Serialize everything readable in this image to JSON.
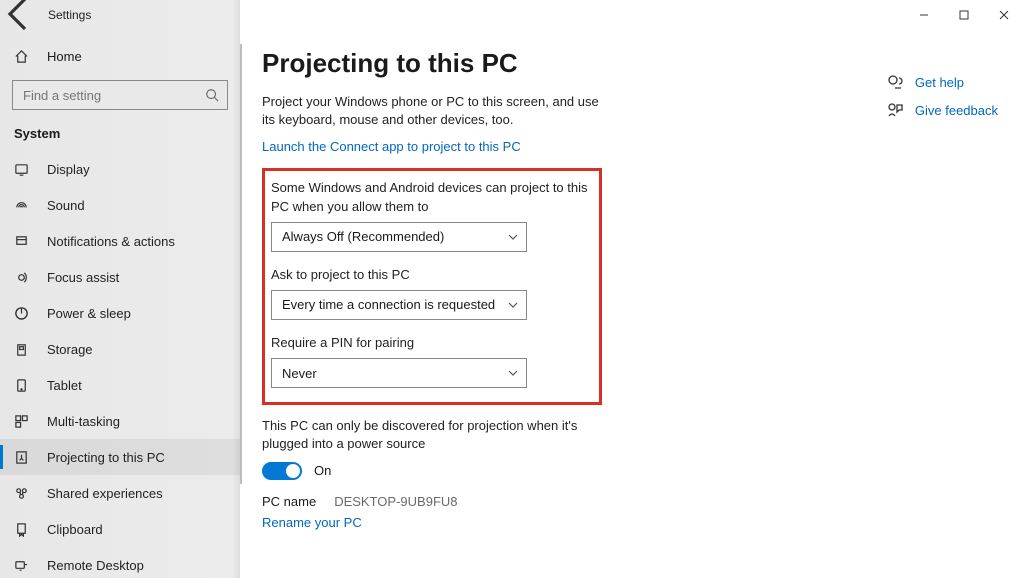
{
  "window": {
    "title": "Settings"
  },
  "sidebar": {
    "home": "Home",
    "search_placeholder": "Find a setting",
    "section": "System",
    "items": [
      {
        "label": "Display"
      },
      {
        "label": "Sound"
      },
      {
        "label": "Notifications & actions"
      },
      {
        "label": "Focus assist"
      },
      {
        "label": "Power & sleep"
      },
      {
        "label": "Storage"
      },
      {
        "label": "Tablet"
      },
      {
        "label": "Multi-tasking"
      },
      {
        "label": "Projecting to this PC"
      },
      {
        "label": "Shared experiences"
      },
      {
        "label": "Clipboard"
      },
      {
        "label": "Remote Desktop"
      }
    ],
    "active_index": 8
  },
  "page": {
    "title": "Projecting to this PC",
    "description": "Project your Windows phone or PC to this screen, and use its keyboard, mouse and other devices, too.",
    "launch_link": "Launch the Connect app to project to this PC",
    "opt1_label": "Some Windows and Android devices can project to this PC when you allow them to",
    "opt1_value": "Always Off (Recommended)",
    "opt2_label": "Ask to project to this PC",
    "opt2_value": "Every time a connection is requested",
    "opt3_label": "Require a PIN for pairing",
    "opt3_value": "Never",
    "discover_label": "This PC can only be discovered for projection when it's plugged into a power source",
    "toggle_state": "On",
    "pcname_label": "PC name",
    "pcname_value": "DESKTOP-9UB9FU8",
    "rename_link": "Rename your PC"
  },
  "right": {
    "help": "Get help",
    "feedback": "Give feedback"
  }
}
